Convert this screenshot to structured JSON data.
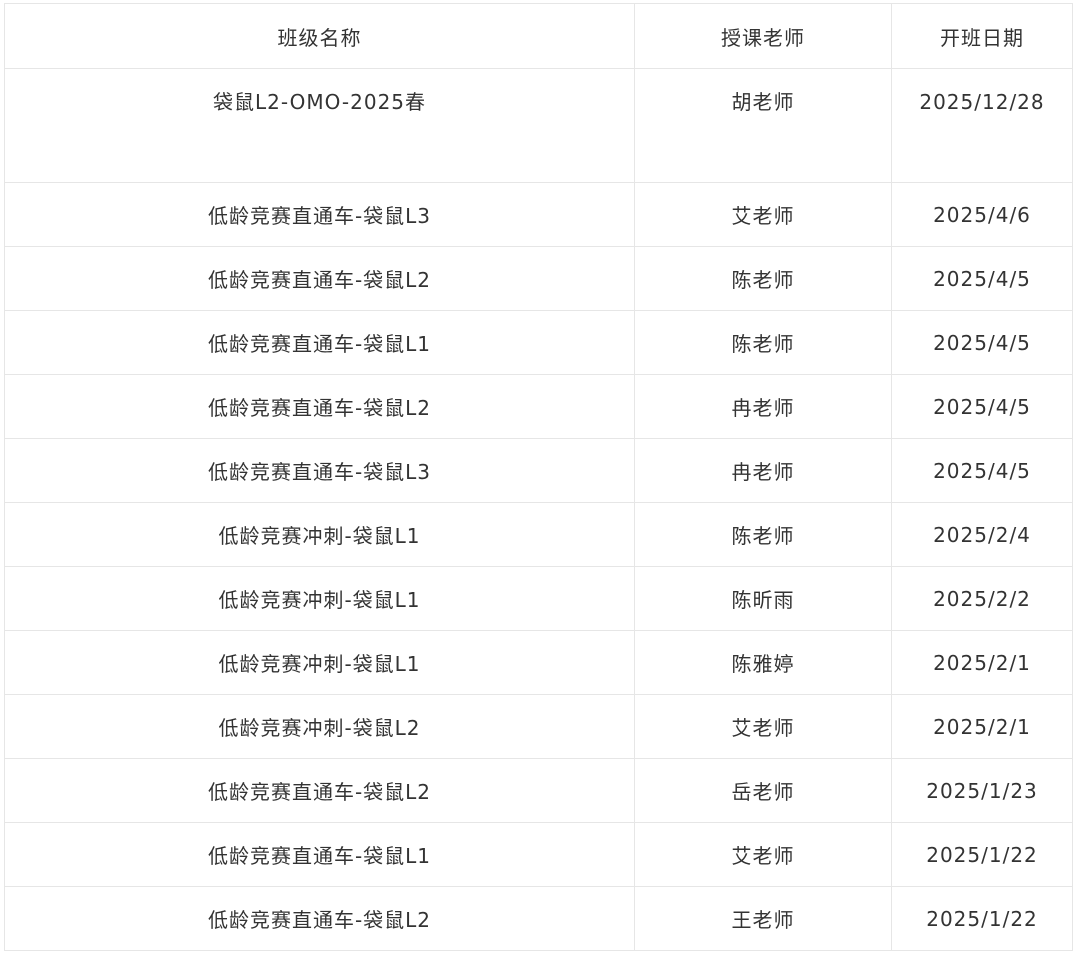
{
  "table": {
    "headers": [
      "班级名称",
      "授课老师",
      "开班日期"
    ],
    "rows": [
      {
        "name": "袋鼠L2-OMO-2025春",
        "teacher": "胡老师",
        "date": "2025/12/28"
      },
      {
        "name": "低龄竞赛直通车-袋鼠L3",
        "teacher": "艾老师",
        "date": "2025/4/6"
      },
      {
        "name": "低龄竞赛直通车-袋鼠L2",
        "teacher": "陈老师",
        "date": "2025/4/5"
      },
      {
        "name": "低龄竞赛直通车-袋鼠L1",
        "teacher": "陈老师",
        "date": "2025/4/5"
      },
      {
        "name": "低龄竞赛直通车-袋鼠L2",
        "teacher": "冉老师",
        "date": "2025/4/5"
      },
      {
        "name": "低龄竞赛直通车-袋鼠L3",
        "teacher": "冉老师",
        "date": "2025/4/5"
      },
      {
        "name": "低龄竞赛冲刺-袋鼠L1",
        "teacher": "陈老师",
        "date": "2025/2/4"
      },
      {
        "name": "低龄竞赛冲刺-袋鼠L1",
        "teacher": "陈昕雨",
        "date": "2025/2/2"
      },
      {
        "name": "低龄竞赛冲刺-袋鼠L1",
        "teacher": "陈雅婷",
        "date": "2025/2/1"
      },
      {
        "name": "低龄竞赛冲刺-袋鼠L2",
        "teacher": "艾老师",
        "date": "2025/2/1"
      },
      {
        "name": "低龄竞赛直通车-袋鼠L2",
        "teacher": "岳老师",
        "date": "2025/1/23"
      },
      {
        "name": "低龄竞赛直通车-袋鼠L1",
        "teacher": "艾老师",
        "date": "2025/1/22"
      },
      {
        "name": "低龄竞赛直通车-袋鼠L2",
        "teacher": "王老师",
        "date": "2025/1/22"
      }
    ]
  }
}
